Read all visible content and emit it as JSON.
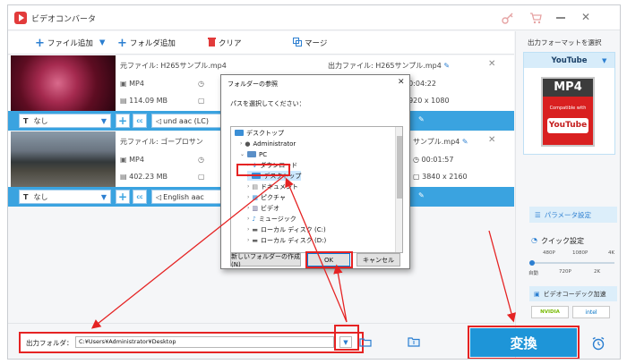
{
  "app": {
    "title": "ビデオコンバータ"
  },
  "toolbar": {
    "add_file": "ファイル追加",
    "add_folder": "フォルダ追加",
    "clear": "クリア",
    "merge": "マージ"
  },
  "videos": [
    {
      "source_label": "元ファイル: H265サンプル.mp4",
      "format": "MP4",
      "size": "114.09 MB",
      "output_label": "出力ファイル: H265サンプル.mp4",
      "duration": "00:04:22",
      "resolution": "1920 x 1080",
      "subtitle": "なし",
      "audio": "und aac (LC)"
    },
    {
      "source_label": "元ファイル: ゴープロサン",
      "format": "MP4",
      "size": "402.23 MB",
      "output_label": "サンプル.mp4",
      "duration": "00:01:57",
      "resolution": "3840 x 2160",
      "subtitle": "なし",
      "audio": "English aac"
    }
  ],
  "right_panel": {
    "heading": "出力フォーマットを選択",
    "format_name": "YouTube",
    "badge_text": "MP4",
    "compatible_text": "Compatible with",
    "youtube_logo": "YouTube",
    "param_button": "パラメータ設定",
    "quick_title": "クイック設定",
    "quality_top": [
      "480P",
      "1080P",
      "4K"
    ],
    "quality_bottom": [
      "自動",
      "720P",
      "2K"
    ],
    "accel_title": "ビデオコーデック加速",
    "gpu_labels": [
      "NVIDIA",
      "intel"
    ]
  },
  "bottom": {
    "folder_label": "出力フォルダ：",
    "folder_path": "C:¥Users¥Administrator¥Desktop",
    "convert_label": "変換"
  },
  "dialog": {
    "title": "フォルダーの参照",
    "prompt": "パスを選択してください：",
    "tree": [
      "デスクトップ",
      "Administrator",
      "PC",
      "ダウンロード",
      "デスクトップ",
      "ドキュメント",
      "ピクチャ",
      "ビデオ",
      "ミュージック",
      "ローカル ディスク (C:)",
      "ローカル ディスク (D:)"
    ],
    "new_folder": "新しいフォルダーの作成(N)",
    "ok": "OK",
    "cancel": "キャンセル",
    "close": "✕"
  },
  "colors": {
    "accent": "#3aa3e0",
    "highlight": "#e52323",
    "convert": "#1e95d8"
  },
  "icons": [
    "app-logo-icon",
    "key-icon",
    "cart-icon",
    "minimize-icon",
    "close-icon",
    "plus-icon",
    "trash-icon",
    "merge-icon",
    "folder-icon",
    "alarm-icon"
  ]
}
